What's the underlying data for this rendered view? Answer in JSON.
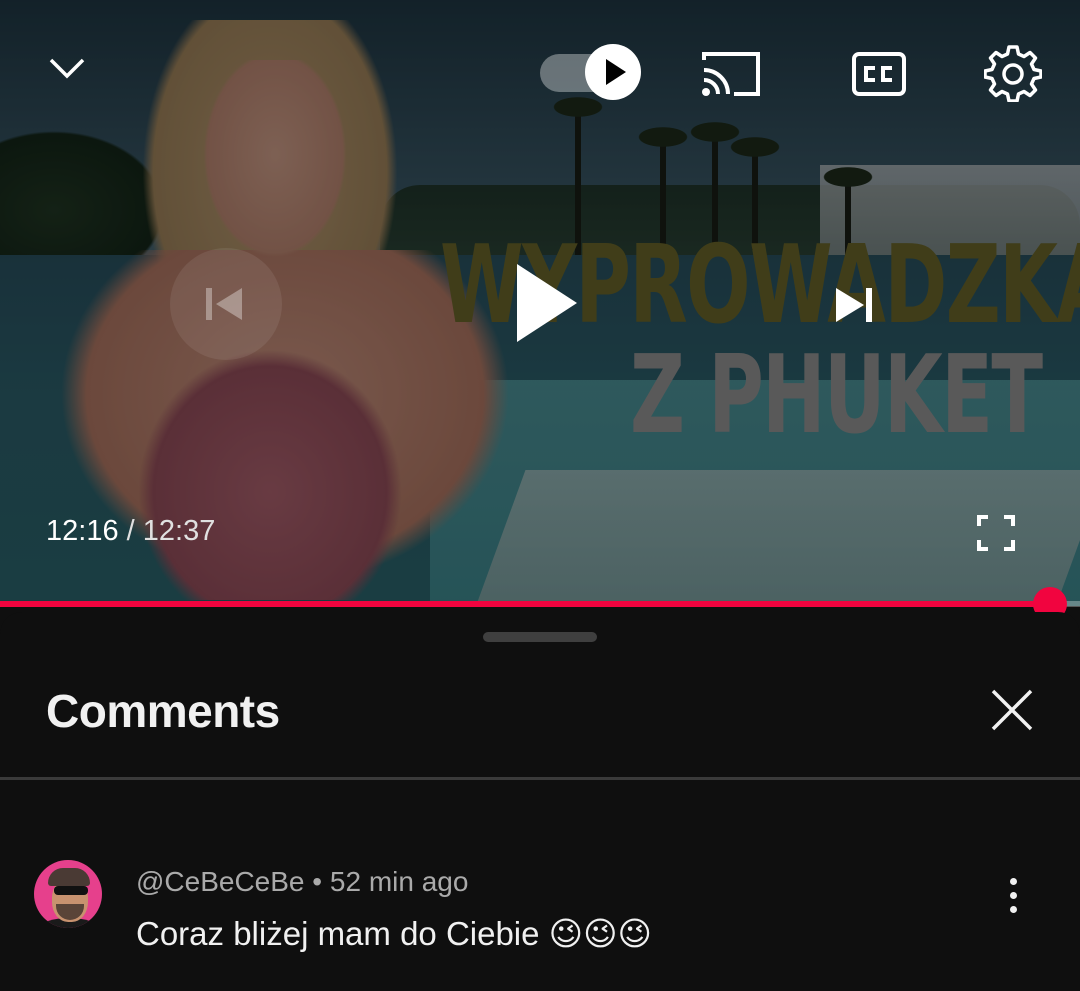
{
  "player": {
    "thumbnail_title_line1": "WYPROWADZKA",
    "thumbnail_title_line2": "Z PHUKET",
    "current_time": "12:16",
    "separator": " / ",
    "duration": "12:37",
    "progress": 0.972,
    "autoplay_on": true,
    "icons": {
      "minimize": "chevron-down-icon",
      "autoplay": "autoplay-toggle",
      "cast": "cast-icon",
      "captions": "cc-icon",
      "settings": "gear-icon",
      "previous": "skip-previous-icon",
      "play": "play-icon",
      "next": "skip-next-icon",
      "fullscreen": "fullscreen-icon"
    },
    "accent_color": "#f1043f"
  },
  "comments_panel": {
    "title": "Comments",
    "comments": [
      {
        "author": "@CeBeCeBe",
        "dot": " • ",
        "time_ago": "52 min ago",
        "text": "Coraz bliżej mam do Ciebie 😉😉😉"
      }
    ]
  }
}
